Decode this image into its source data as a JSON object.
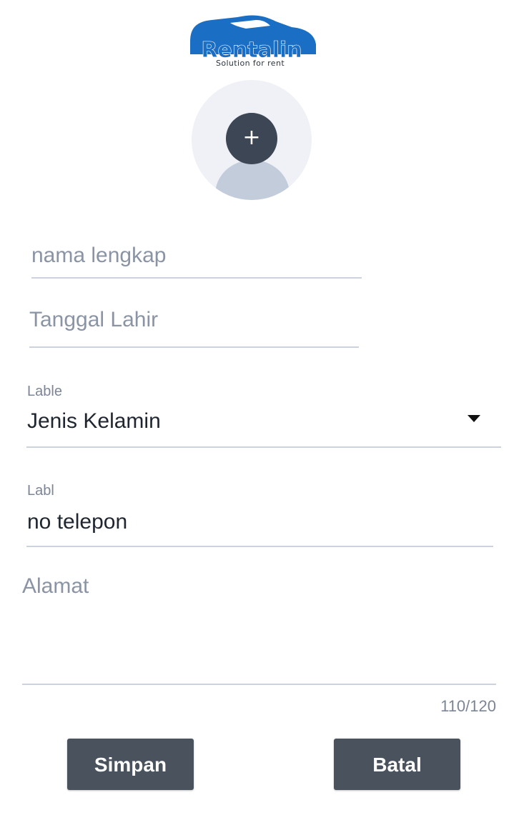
{
  "logo": {
    "brand": "Rentalin",
    "tagline": "Solution for rent",
    "color": "#1a6fc4"
  },
  "avatar": {
    "add_icon": "plus-icon",
    "add_glyph": "+"
  },
  "form": {
    "nama": {
      "placeholder": "nama lengkap",
      "value": ""
    },
    "tanggal_lahir": {
      "placeholder": "Tanggal Lahir",
      "value": ""
    },
    "jenis_kelamin": {
      "label": "Lable",
      "value": "Jenis Kelamin",
      "icon": "caret-down-icon"
    },
    "telepon": {
      "label": "Labl",
      "value": "no telepon"
    },
    "alamat": {
      "placeholder": "Alamat",
      "value": "",
      "counter": "110/120"
    }
  },
  "buttons": {
    "save_label": "Simpan",
    "cancel_label": "Batal"
  },
  "colors": {
    "button_bg": "#4a525e",
    "avatar_bg": "#eff1f6",
    "avatar_figure": "#c3ccda",
    "add_button": "#3d4654",
    "underline": "#ccd3de"
  }
}
